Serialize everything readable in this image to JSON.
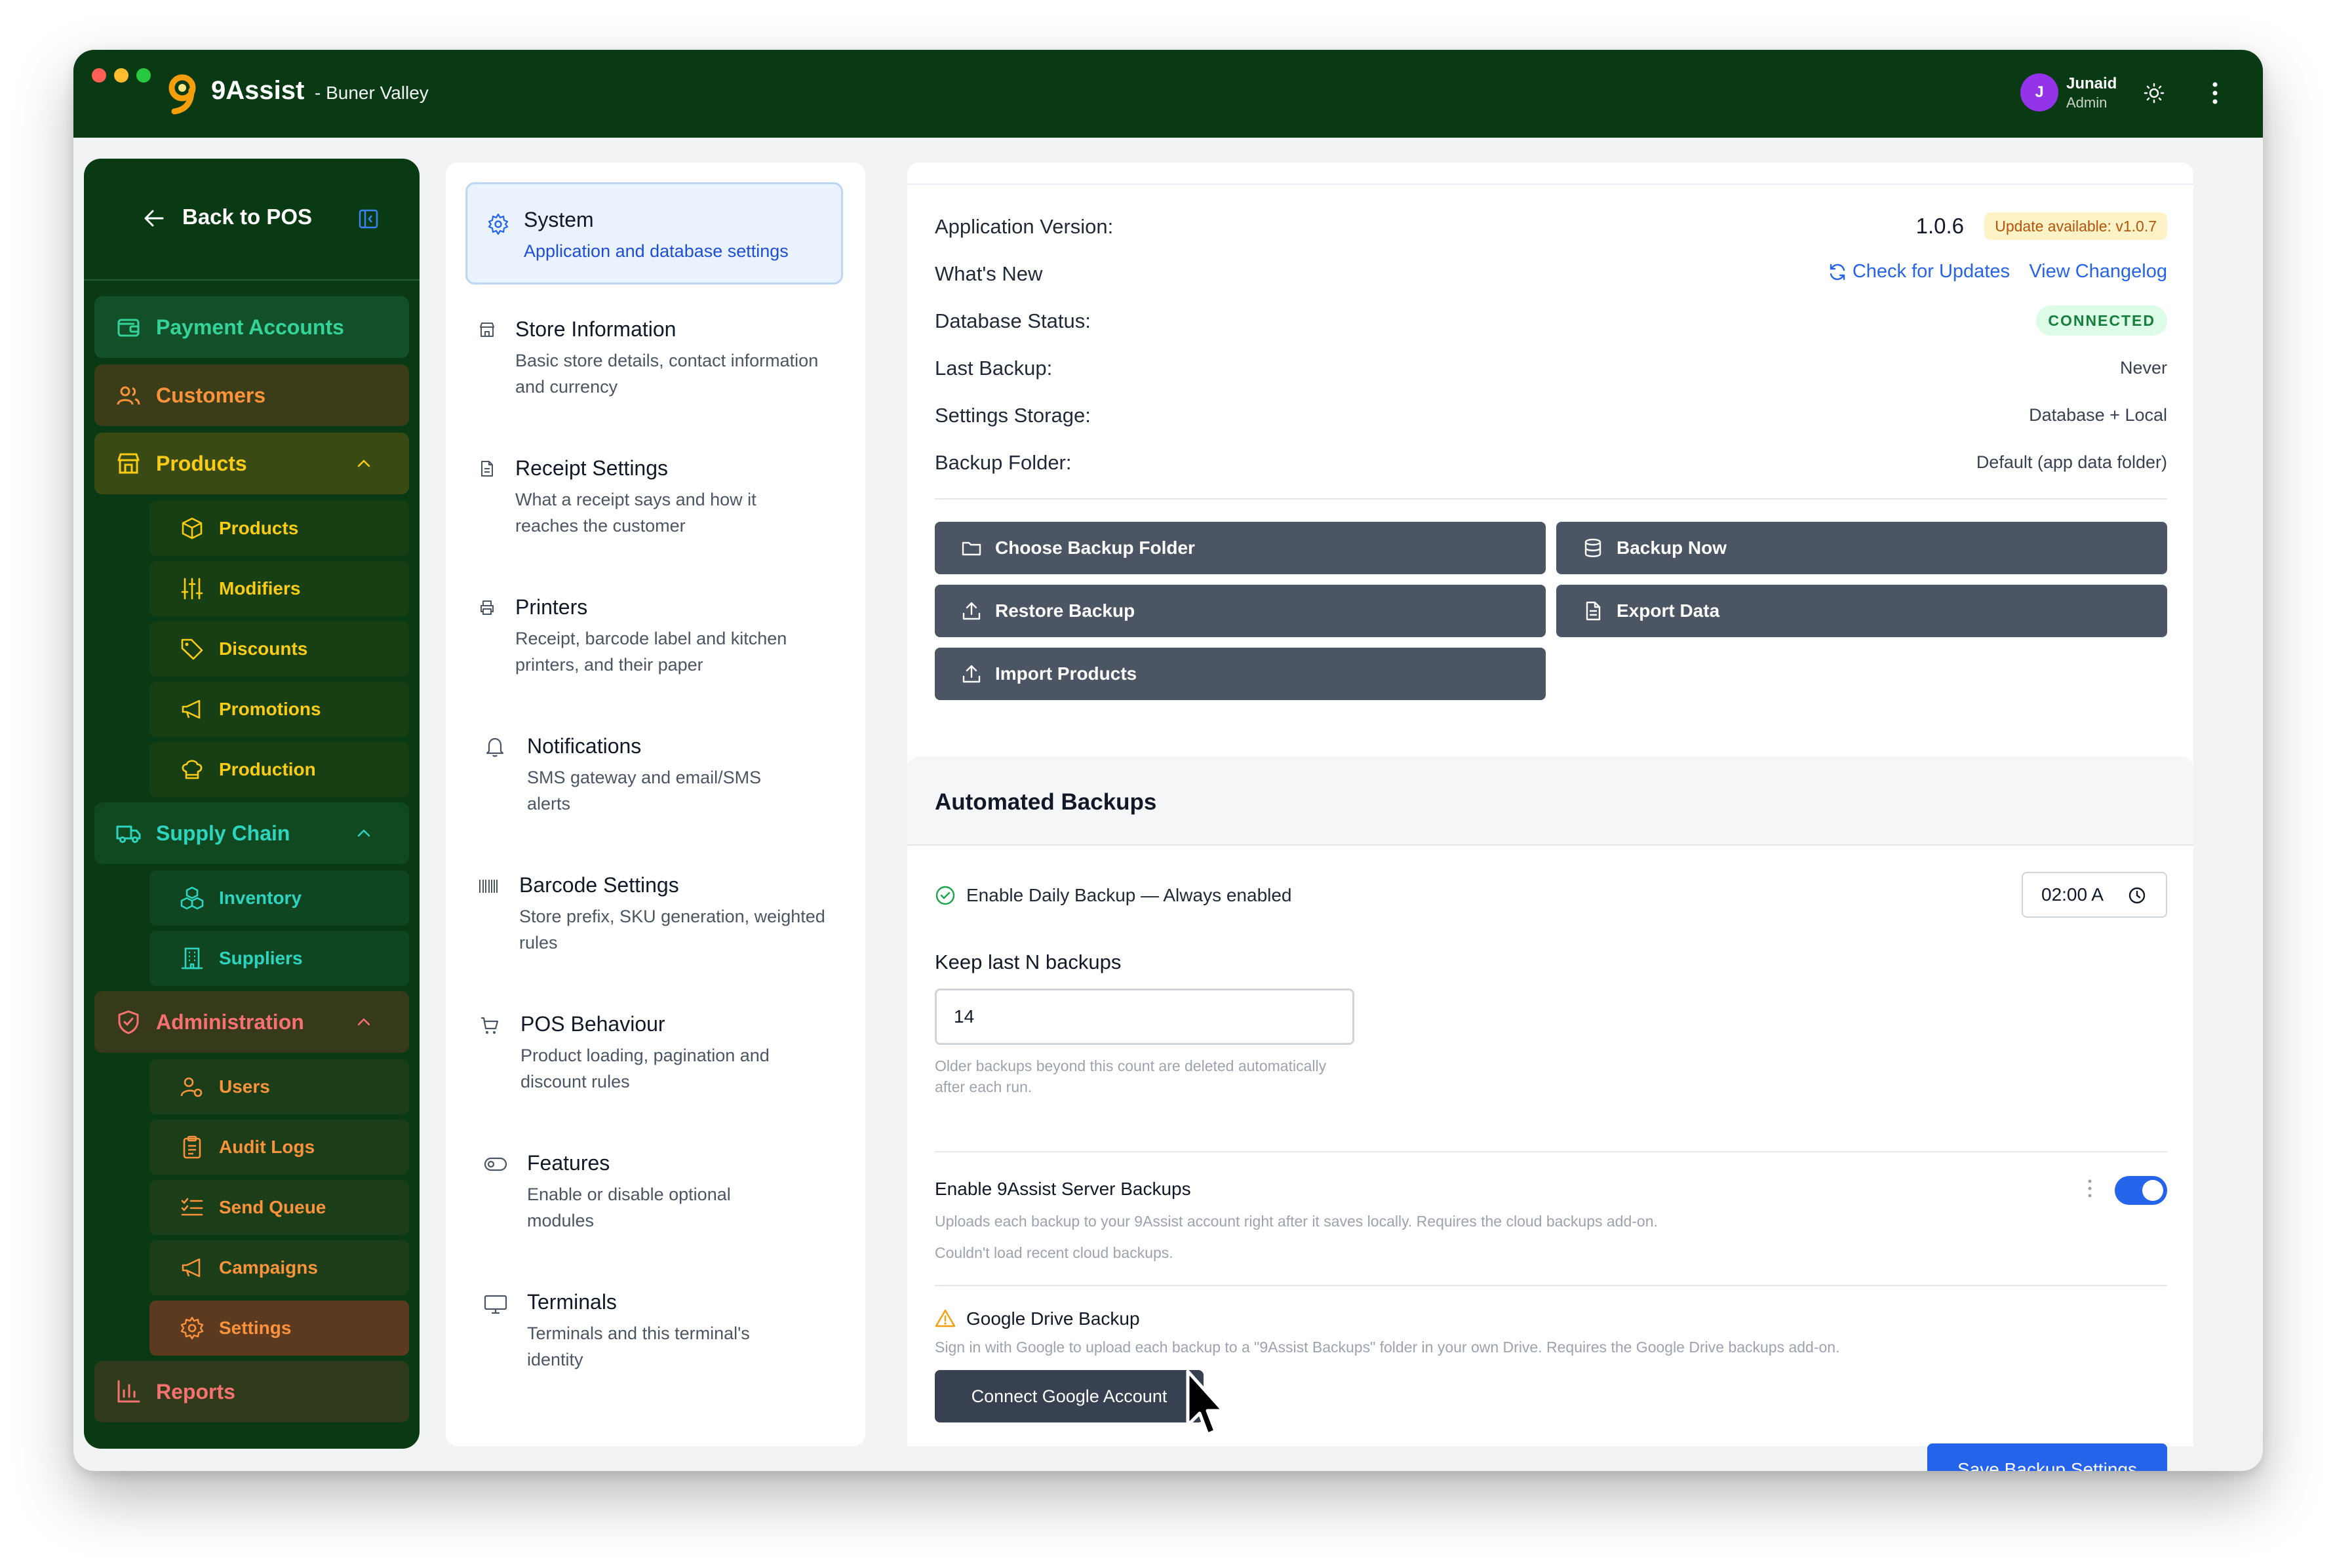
{
  "app": {
    "name": "9Assist",
    "branch": "- Buner Valley"
  },
  "user": {
    "initial": "J",
    "name": "Junaid",
    "role": "Admin"
  },
  "sidebar": {
    "back_label": "Back to POS",
    "payment_accounts": "Payment Accounts",
    "customers": "Customers",
    "products_group": "Products",
    "products_items": [
      "Products",
      "Modifiers",
      "Discounts",
      "Promotions",
      "Production"
    ],
    "supply_chain_group": "Supply Chain",
    "supply_items": [
      "Inventory",
      "Suppliers"
    ],
    "administration_group": "Administration",
    "admin_items": [
      "Users",
      "Audit Logs",
      "Send Queue",
      "Campaigns",
      "Settings"
    ],
    "reports": "Reports",
    "colors": {
      "green": "#34d399",
      "gold": "#facc15",
      "orange": "#fb923c",
      "red": "#f87171",
      "teal": "#2dd4bf"
    }
  },
  "settings_menu": [
    {
      "title": "System",
      "desc": "Application and database settings",
      "icon": "gear-icon"
    },
    {
      "title": "Store Information",
      "desc": "Basic store details, contact information and currency",
      "icon": "store-icon"
    },
    {
      "title": "Receipt Settings",
      "desc": "What a receipt says and how it reaches the customer",
      "icon": "receipt-icon"
    },
    {
      "title": "Printers",
      "desc": "Receipt, barcode label and kitchen printers, and their paper",
      "icon": "printer-icon"
    },
    {
      "title": "Notifications",
      "desc": "SMS gateway and email/SMS alerts",
      "icon": "bell-icon"
    },
    {
      "title": "Barcode Settings",
      "desc": "Store prefix, SKU generation, weighted rules",
      "icon": "barcode-icon"
    },
    {
      "title": "POS Behaviour",
      "desc": "Product loading, pagination and discount rules",
      "icon": "cart-icon"
    },
    {
      "title": "Features",
      "desc": "Enable or disable optional modules",
      "icon": "toggle-icon"
    },
    {
      "title": "Terminals",
      "desc": "Terminals and this terminal's identity",
      "icon": "monitor-icon"
    }
  ],
  "system": {
    "app_version_label": "Application Version:",
    "app_version": "1.0.6",
    "update_badge": "Update available: v1.0.7",
    "whats_new_label": "What's New",
    "check_updates": "Check for Updates",
    "view_changelog": "View Changelog",
    "db_status_label": "Database Status:",
    "db_status": "CONNECTED",
    "last_backup_label": "Last Backup:",
    "last_backup": "Never",
    "storage_label": "Settings Storage:",
    "storage": "Database + Local",
    "folder_label": "Backup Folder:",
    "folder": "Default (app data folder)",
    "buttons": {
      "choose_folder": "Choose Backup Folder",
      "backup_now": "Backup Now",
      "restore": "Restore Backup",
      "export": "Export Data",
      "import": "Import Products"
    }
  },
  "automated": {
    "title": "Automated Backups",
    "daily_label": "Enable Daily Backup — Always enabled",
    "time": "02:00 A",
    "keep_label": "Keep last N backups",
    "keep_value": "14",
    "keep_help": "Older backups beyond this count are deleted automatically after each run.",
    "server_title": "Enable 9Assist Server Backups",
    "server_desc": "Uploads each backup to your 9Assist account right after it saves locally. Requires the cloud backups add-on.",
    "server_error": "Couldn't load recent cloud backups.",
    "server_enabled": true,
    "gdrive_title": "Google Drive Backup",
    "gdrive_desc": "Sign in with Google to upload each backup to a \"9Assist Backups\" folder in your own Drive. Requires the Google Drive backups add-on.",
    "connect_button": "Connect Google Account",
    "save_button": "Save Backup Settings"
  }
}
